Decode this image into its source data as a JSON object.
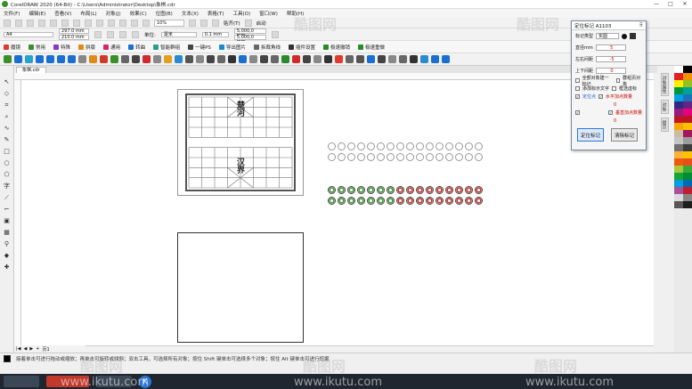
{
  "window": {
    "title": "CorelDRAW 2020 (64-Bit) - C:\\Users\\Administrator\\Desktop\\象棋.cdr",
    "controls": [
      "—",
      "□",
      "✕"
    ]
  },
  "menu": [
    "文件(F)",
    "编辑(E)",
    "查看(V)",
    "布局(L)",
    "对象(J)",
    "效果(C)",
    "位图(B)",
    "文本(X)",
    "表格(T)",
    "工具(O)",
    "窗口(W)",
    "帮助(H)"
  ],
  "toolbar": {
    "zoom": "10%",
    "snap_label": "贴齐(T)",
    "launch_label": "启动"
  },
  "property_bar": {
    "paper": "A4",
    "width": "297.0 mm",
    "height": "210.0 mm",
    "units_label": "单位:",
    "units": "毫米",
    "nudge": "0.1 mm",
    "dup_x": "5.000,0 mm",
    "dup_y": "5.000,0 mm"
  },
  "plugin_bar": [
    {
      "label": "魔镜",
      "color": "#e03a2f"
    },
    {
      "label": "常用",
      "color": "#3a8f2a"
    },
    {
      "label": "特殊",
      "color": "#8a3ab8"
    },
    {
      "label": "拼版",
      "color": "#e08a1a"
    },
    {
      "label": "通用",
      "color": "#d02a6a"
    },
    {
      "label": "转曲",
      "color": "#1a6fd0"
    },
    {
      "label": "智能群组",
      "color": "#2aa08a"
    },
    {
      "label": "一键PS",
      "color": "#444444"
    },
    {
      "label": "导出图片",
      "color": "#1a8ad0"
    },
    {
      "label": "拆裁角线",
      "color": "#666666"
    },
    {
      "label": "插件设置",
      "color": "#333333"
    },
    {
      "label": "极速撤销",
      "color": "#2a8a2a"
    },
    {
      "label": "极速重做",
      "color": "#2a8a2a"
    }
  ],
  "document_tab": "象棋.cdr",
  "board_text": {
    "top": "楚河",
    "bottom": "汉界"
  },
  "page_nav": {
    "page_label": "页1"
  },
  "status": {
    "message": "接着单击可进行拖动或缩放；再单击可旋转或倾斜；双击工具，可选择所有对象；按住 Shift 键单击可选择多个对象；按住 Alt 键单击可进行挖掘"
  },
  "dialog": {
    "title": "定位标记 A1103",
    "mark_type_label": "标记类型",
    "mark_type_value": "实圆",
    "diameter_label": "直径mm",
    "diameter_value": "5",
    "lr_dist_label": "左右间距",
    "lr_dist_value": "-5",
    "tb_dist_label": "上下间距",
    "tb_dist_value": "0",
    "check_all_objects": "全部对象建一标记",
    "check_group": "群组页对象",
    "check_add_number": "添加标示文字",
    "check_frame": "框选虚标",
    "location_label": "定位点",
    "h_add_label": "水平加点数量",
    "h_add_value": "0",
    "v_add_label": "垂直加点数量",
    "v_add_value": "0",
    "btn_mark": "定位标记",
    "btn_clear": "清除标记"
  },
  "watermark": {
    "site": "www.ikutu.com",
    "brand": "酷图网"
  },
  "taskbar": {
    "cdr_label": "K"
  },
  "palette": [
    "#ffffff",
    "#000000",
    "#e31e24",
    "#f39200",
    "#ffed00",
    "#95c11f",
    "#009640",
    "#00a19a",
    "#009fe3",
    "#1d71b8",
    "#312783",
    "#662483",
    "#951b81",
    "#e6007e",
    "#be1622",
    "#bd1622",
    "#f7a600",
    "#fcc200",
    "#cbbba0",
    "#a2195b",
    "#c6c6c6",
    "#9d9d9d",
    "#706f6f",
    "#3c3c3b",
    "#f9b233",
    "#fdc300",
    "#ea5b0c",
    "#e94e1b",
    "#a8c93b",
    "#3aaa35",
    "#13a538",
    "#008d36",
    "#00a0e0",
    "#0069b4",
    "#a6529a",
    "#be1e2d",
    "#dadada",
    "#878787",
    "#575756",
    "#1d1d1b"
  ]
}
